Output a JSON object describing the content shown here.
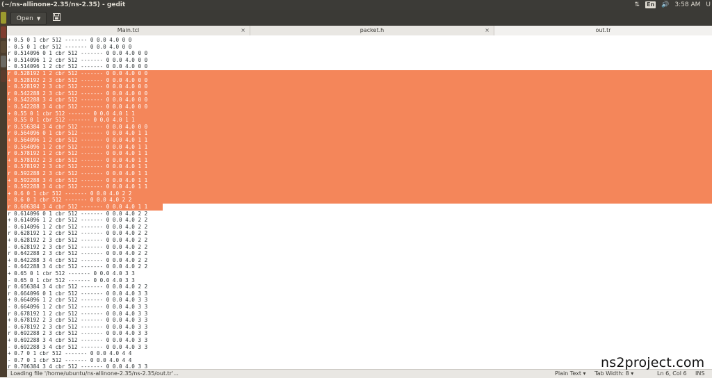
{
  "window": {
    "title": "(~/ns-allinone-2.35/ns-2.35) - gedit"
  },
  "panel": {
    "lang": "En",
    "time": "3:58 AM",
    "user_initial": "U"
  },
  "toolbar": {
    "open_label": "Open"
  },
  "tabs": [
    {
      "label": "Main.tcl"
    },
    {
      "label": "packet.h"
    },
    {
      "label": "out.tr"
    }
  ],
  "tab_close_glyph": "×",
  "editor": {
    "selection_color": "#f4865a",
    "selection": {
      "first_line": 5,
      "last_line": 25
    },
    "lines": [
      "+ 0.5 0 1 cbr 512 ------- 0 0.0 4.0 0 0",
      "- 0.5 0 1 cbr 512 ------- 0 0.0 4.0 0 0",
      "r 0.514096 0 1 cbr 512 ------- 0 0.0 4.0 0 0",
      "+ 0.514096 1 2 cbr 512 ------- 0 0.0 4.0 0 0",
      "- 0.514096 1 2 cbr 512 ------- 0 0.0 4.0 0 0",
      "r 0.528192 1 2 cbr 512 ------- 0 0.0 4.0 0 0",
      "+ 0.528192 2 3 cbr 512 ------- 0 0.0 4.0 0 0",
      "- 0.528192 2 3 cbr 512 ------- 0 0.0 4.0 0 0",
      "r 0.542288 2 3 cbr 512 ------- 0 0.0 4.0 0 0",
      "+ 0.542288 3 4 cbr 512 ------- 0 0.0 4.0 0 0",
      "- 0.542288 3 4 cbr 512 ------- 0 0.0 4.0 0 0",
      "+ 0.55 0 1 cbr 512 ------- 0 0.0 4.0 1 1",
      "- 0.55 0 1 cbr 512 ------- 0 0.0 4.0 1 1",
      "r 0.556384 3 4 cbr 512 ------- 0 0.0 4.0 0 0",
      "r 0.564096 0 1 cbr 512 ------- 0 0.0 4.0 1 1",
      "+ 0.564096 1 2 cbr 512 ------- 0 0.0 4.0 1 1",
      "- 0.564096 1 2 cbr 512 ------- 0 0.0 4.0 1 1",
      "r 0.578192 1 2 cbr 512 ------- 0 0.0 4.0 1 1",
      "+ 0.578192 2 3 cbr 512 ------- 0 0.0 4.0 1 1",
      "- 0.578192 2 3 cbr 512 ------- 0 0.0 4.0 1 1",
      "r 0.592288 2 3 cbr 512 ------- 0 0.0 4.0 1 1",
      "+ 0.592288 3 4 cbr 512 ------- 0 0.0 4.0 1 1",
      "- 0.592288 3 4 cbr 512 ------- 0 0.0 4.0 1 1",
      "+ 0.6 0 1 cbr 512 ------- 0 0.0 4.0 2 2",
      "- 0.6 0 1 cbr 512 ------- 0 0.0 4.0 2 2",
      "r 0.606384 3 4 cbr 512 ------- 0 0.0 4.0 1 1",
      "r 0.614096 0 1 cbr 512 ------- 0 0.0 4.0 2 2",
      "+ 0.614096 1 2 cbr 512 ------- 0 0.0 4.0 2 2",
      "- 0.614096 1 2 cbr 512 ------- 0 0.0 4.0 2 2",
      "r 0.628192 1 2 cbr 512 ------- 0 0.0 4.0 2 2",
      "+ 0.628192 2 3 cbr 512 ------- 0 0.0 4.0 2 2",
      "- 0.628192 2 3 cbr 512 ------- 0 0.0 4.0 2 2",
      "r 0.642288 2 3 cbr 512 ------- 0 0.0 4.0 2 2",
      "+ 0.642288 3 4 cbr 512 ------- 0 0.0 4.0 2 2",
      "- 0.642288 3 4 cbr 512 ------- 0 0.0 4.0 2 2",
      "+ 0.65 0 1 cbr 512 ------- 0 0.0 4.0 3 3",
      "- 0.65 0 1 cbr 512 ------- 0 0.0 4.0 3 3",
      "r 0.656384 3 4 cbr 512 ------- 0 0.0 4.0 2 2",
      "r 0.664096 0 1 cbr 512 ------- 0 0.0 4.0 3 3",
      "+ 0.664096 1 2 cbr 512 ------- 0 0.0 4.0 3 3",
      "- 0.664096 1 2 cbr 512 ------- 0 0.0 4.0 3 3",
      "r 0.678192 1 2 cbr 512 ------- 0 0.0 4.0 3 3",
      "+ 0.678192 2 3 cbr 512 ------- 0 0.0 4.0 3 3",
      "- 0.678192 2 3 cbr 512 ------- 0 0.0 4.0 3 3",
      "r 0.692288 2 3 cbr 512 ------- 0 0.0 4.0 3 3",
      "+ 0.692288 3 4 cbr 512 ------- 0 0.0 4.0 3 3",
      "- 0.692288 3 4 cbr 512 ------- 0 0.0 4.0 3 3",
      "+ 0.7 0 1 cbr 512 ------- 0 0.0 4.0 4 4",
      "- 0.7 0 1 cbr 512 ------- 0 0.0 4.0 4 4",
      "r 0.706384 3 4 cbr 512 ------- 0 0.0 4.0 3 3"
    ]
  },
  "status": {
    "message": "Loading file '/home/ubuntu/ns-allinone-2.35/ns-2.35/out.tr'...",
    "language": "Plain Text",
    "tab_width": "Tab Width: 8",
    "position": "Ln 6, Col 6",
    "ins": "INS"
  },
  "watermark": "ns2project.com"
}
